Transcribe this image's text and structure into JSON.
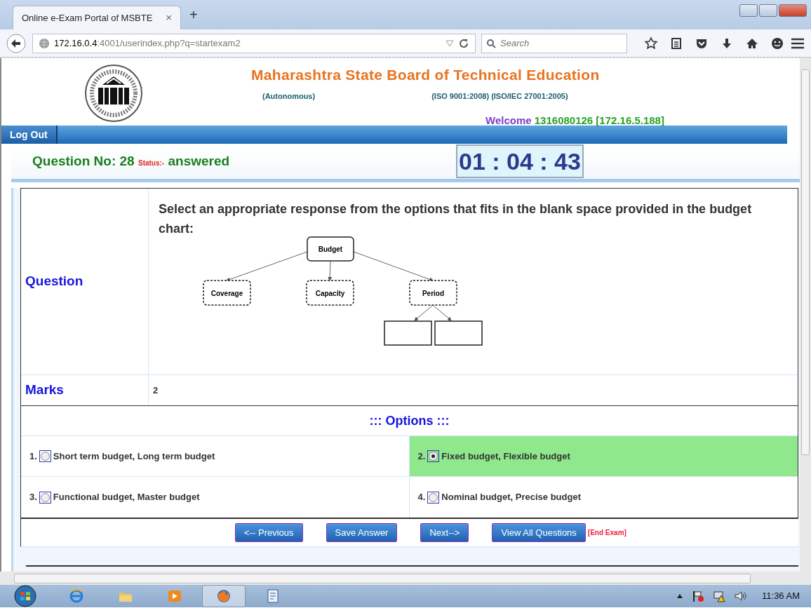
{
  "browser": {
    "tab_title": "Online e-Exam Portal of MSBTE",
    "tab_close": "×",
    "new_tab": "+",
    "url_host": "172.16.0.4",
    "url_path": ":4001/userindex.php?q=startexam2",
    "search_placeholder": "Search"
  },
  "header": {
    "title": "Maharashtra State Board of Technical Education",
    "autonomous": "(Autonomous)",
    "iso": "(ISO 9001:2008) (ISO/IEC 27001:2005)",
    "welcome_label": "Welcome",
    "welcome_user": "1316080126 [172.16.5.188]"
  },
  "menu": [
    "Log Out"
  ],
  "question_bar": {
    "label": "Question No: 28",
    "status_label": "Status:-",
    "status": "answered",
    "timer": "01 : 04 : 43"
  },
  "question": {
    "label": "Question",
    "text": "Select an appropriate response from the options that fits in the blank space provided in the budget chart:",
    "diagram": {
      "root": "Budget",
      "children": [
        {
          "label": "Coverage"
        },
        {
          "label": "Capacity"
        },
        {
          "label": "Period",
          "children": [
            {
              "kind": "blank"
            },
            {
              "kind": "blank"
            }
          ]
        }
      ]
    }
  },
  "marks": {
    "label": "Marks",
    "value": "2"
  },
  "options": {
    "title": "::: Options :::",
    "items": [
      {
        "number": "1.",
        "text": "Short term budget, Long term budget",
        "selected": false
      },
      {
        "number": "2.",
        "text": "Fixed budget, Flexible budget",
        "selected": true
      },
      {
        "number": "3.",
        "text": "Functional budget, Master budget",
        "selected": false
      },
      {
        "number": "4.",
        "text": "Nominal budget, Precise budget",
        "selected": false
      }
    ]
  },
  "buttons": [
    "<-- Previous",
    "Save Answer",
    "Next-->",
    "View All Questions"
  ],
  "end_exam": "[End Exam]",
  "taskbar": {
    "time": "11:36 AM"
  }
}
